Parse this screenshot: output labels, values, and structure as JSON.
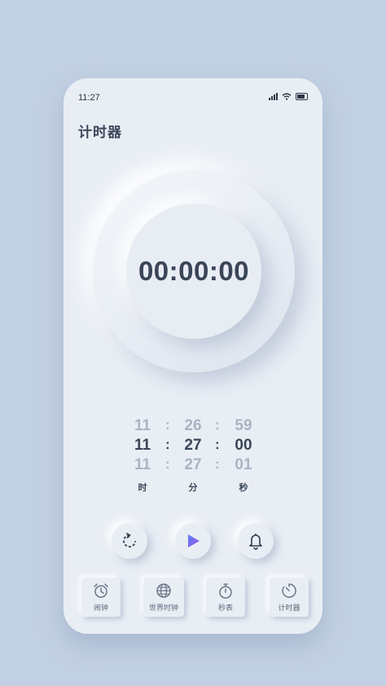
{
  "status_bar": {
    "time": "11:27"
  },
  "header": {
    "title": "计时器"
  },
  "timer": {
    "display": "00:00:00"
  },
  "picker": {
    "hours": {
      "prev": "11",
      "current": "11",
      "next": "11",
      "unit": "时"
    },
    "minutes": {
      "prev": "26",
      "current": "27",
      "next": "27",
      "unit": "分"
    },
    "seconds": {
      "prev": "59",
      "current": "00",
      "next": "01",
      "unit": "秒"
    },
    "separator": ":"
  },
  "controls": {
    "reset_icon": "reset-icon",
    "play_icon": "play-icon",
    "bell_icon": "bell-icon",
    "play_color": "#7a5df2"
  },
  "nav": {
    "items": [
      {
        "label": "闹钟",
        "icon": "alarm-clock-icon"
      },
      {
        "label": "世界时钟",
        "icon": "globe-icon"
      },
      {
        "label": "秒表",
        "icon": "stopwatch-icon"
      },
      {
        "label": "计时器",
        "icon": "timer-icon"
      }
    ]
  },
  "colors": {
    "background": "#c2d0e3",
    "surface": "#e9eef5",
    "text": "#3a4558"
  }
}
